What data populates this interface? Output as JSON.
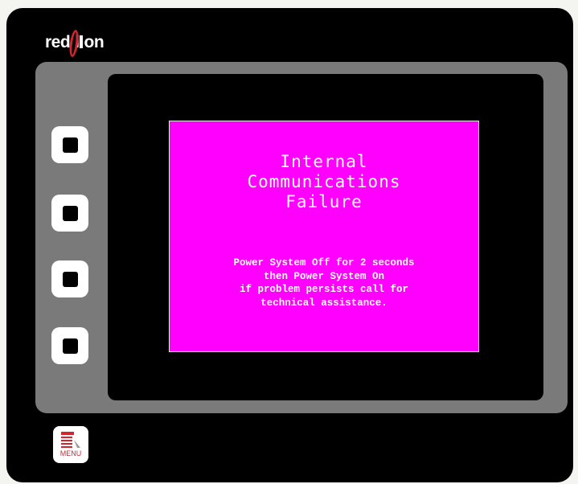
{
  "brand": {
    "logo_word1": "red",
    "logo_word2_start": "l",
    "logo_word2_end": "on"
  },
  "screen": {
    "background_color": "#ff00ff",
    "title_lines": [
      "Internal",
      "Communications",
      "Failure"
    ],
    "message_lines": [
      "Power System Off for 2 seconds",
      "then Power System On",
      "if problem persists call for",
      "technical assistance."
    ]
  },
  "softkeys": [
    {
      "icon": "square-key-icon"
    },
    {
      "icon": "square-key-icon"
    },
    {
      "icon": "square-key-icon"
    },
    {
      "icon": "square-key-icon"
    }
  ],
  "menu_button": {
    "label": "MENU",
    "icon": "menu-list-icon",
    "accent_color": "#d4252f"
  }
}
